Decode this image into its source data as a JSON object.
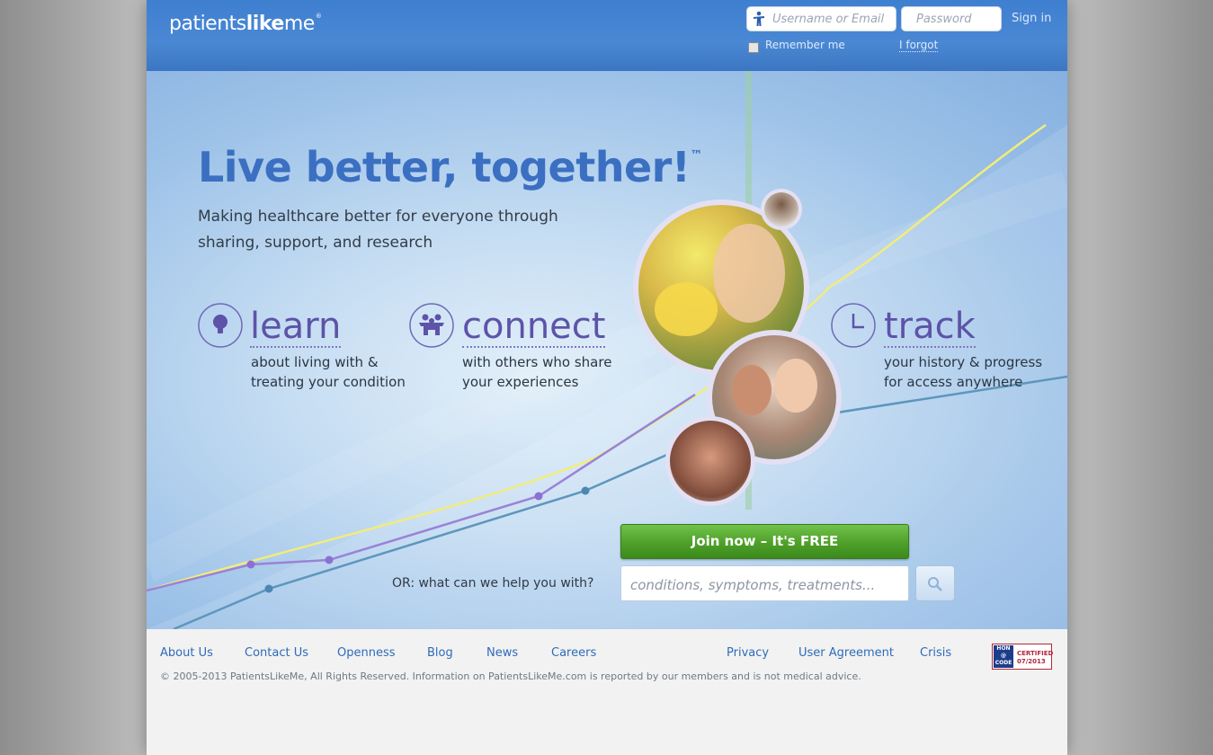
{
  "header": {
    "logo_light": "patients",
    "logo_bold": "like",
    "logo_end": "me",
    "logo_mark": "®",
    "username_placeholder": "Username or Email",
    "password_placeholder": "Password",
    "signin_label": "Sign in",
    "remember_label": "Remember me",
    "forgot_label": "I forgot"
  },
  "hero": {
    "headline": "Live better, together!",
    "headline_mark": "™",
    "subline": "Making healthcare better for everyone through sharing, support, and research",
    "features": [
      {
        "title": "learn",
        "text_line1": "about living with &",
        "text_line2": "treating your condition",
        "icon": "lightbulb-icon"
      },
      {
        "title": "connect",
        "text_line1": "with others who share",
        "text_line2": "your experiences",
        "icon": "people-icon"
      },
      {
        "title": "track",
        "text_line1": "your history & progress",
        "text_line2": "for access anywhere",
        "icon": "clock-icon"
      }
    ],
    "join_label": "Join now – It's FREE",
    "or_text": "OR: what can we help you with?",
    "search_placeholder": "conditions, symptoms, treatments...",
    "search_icon": "magnifier-icon"
  },
  "footer": {
    "links_left": [
      "About Us",
      "Contact Us",
      "Openness",
      "Blog",
      "News",
      "Careers"
    ],
    "links_right": [
      "Privacy",
      "User Agreement",
      "Crisis"
    ],
    "copyright": "© 2005-2013 PatientsLikeMe, All Rights Reserved. Information on PatientsLikeMe.com is reported by our members and is not medical advice.",
    "hon_logo": "HON\n@\nCODE",
    "hon_line1": "CERTIFIED",
    "hon_line2": "07/2013"
  },
  "colors": {
    "brand_blue": "#3f7fd0",
    "headline_blue": "#3b6fc1",
    "feature_purple": "#5d53a8",
    "join_green": "#4ea02a",
    "link_blue": "#2f6bb8"
  }
}
